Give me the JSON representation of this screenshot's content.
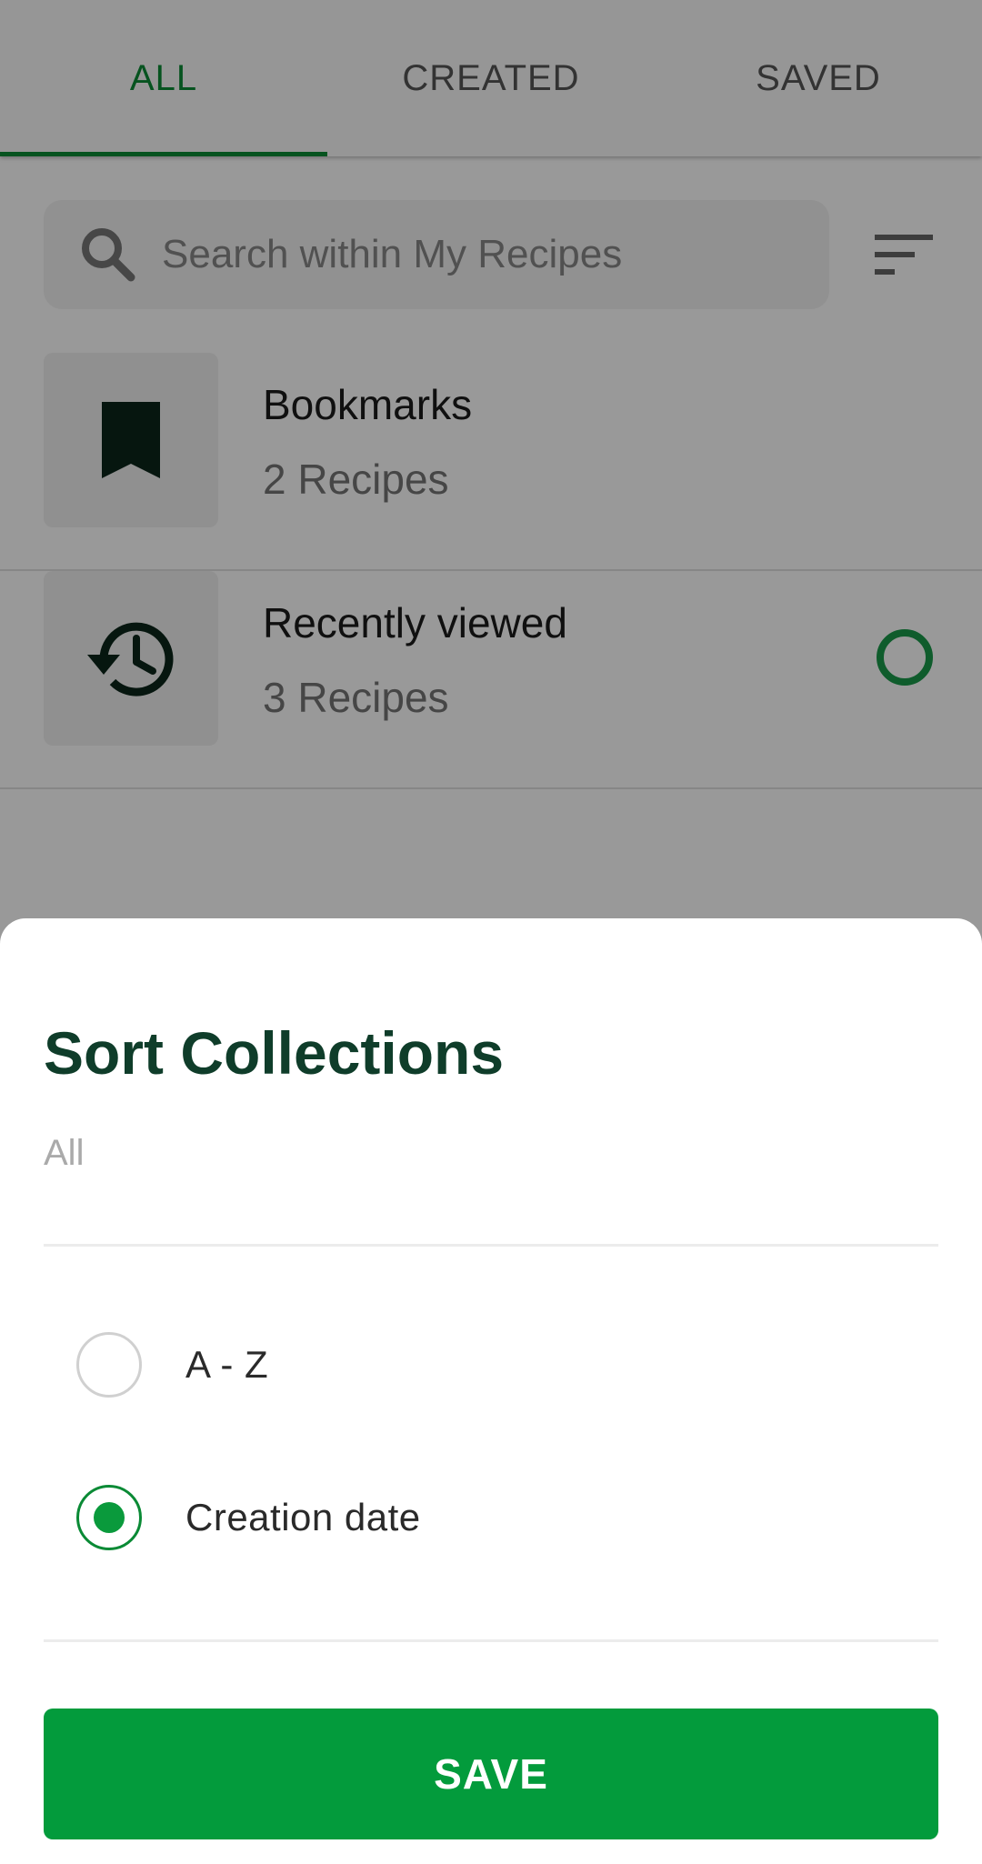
{
  "tabs": [
    {
      "label": "ALL",
      "active": true
    },
    {
      "label": "CREATED",
      "active": false
    },
    {
      "label": "SAVED",
      "active": false
    }
  ],
  "search": {
    "placeholder": "Search within My Recipes",
    "icon": "search-icon"
  },
  "filter": {
    "icon": "filter-icon"
  },
  "collections": [
    {
      "title": "Bookmarks",
      "count": "2 Recipes",
      "icon": "bookmark-icon"
    },
    {
      "title": "Recently viewed",
      "count": "3 Recipes",
      "icon": "history-icon",
      "indicator": "loading-ring"
    }
  ],
  "sort_sheet": {
    "title": "Sort Collections",
    "subtitle": "All",
    "options": [
      {
        "label": "A - Z",
        "selected": false
      },
      {
        "label": "Creation date",
        "selected": true
      }
    ],
    "save_label": "SAVE"
  },
  "colors": {
    "accent": "#0a8a35",
    "button": "#039b3c",
    "title": "#0f3d2a",
    "icon_dark": "#0b2519"
  }
}
